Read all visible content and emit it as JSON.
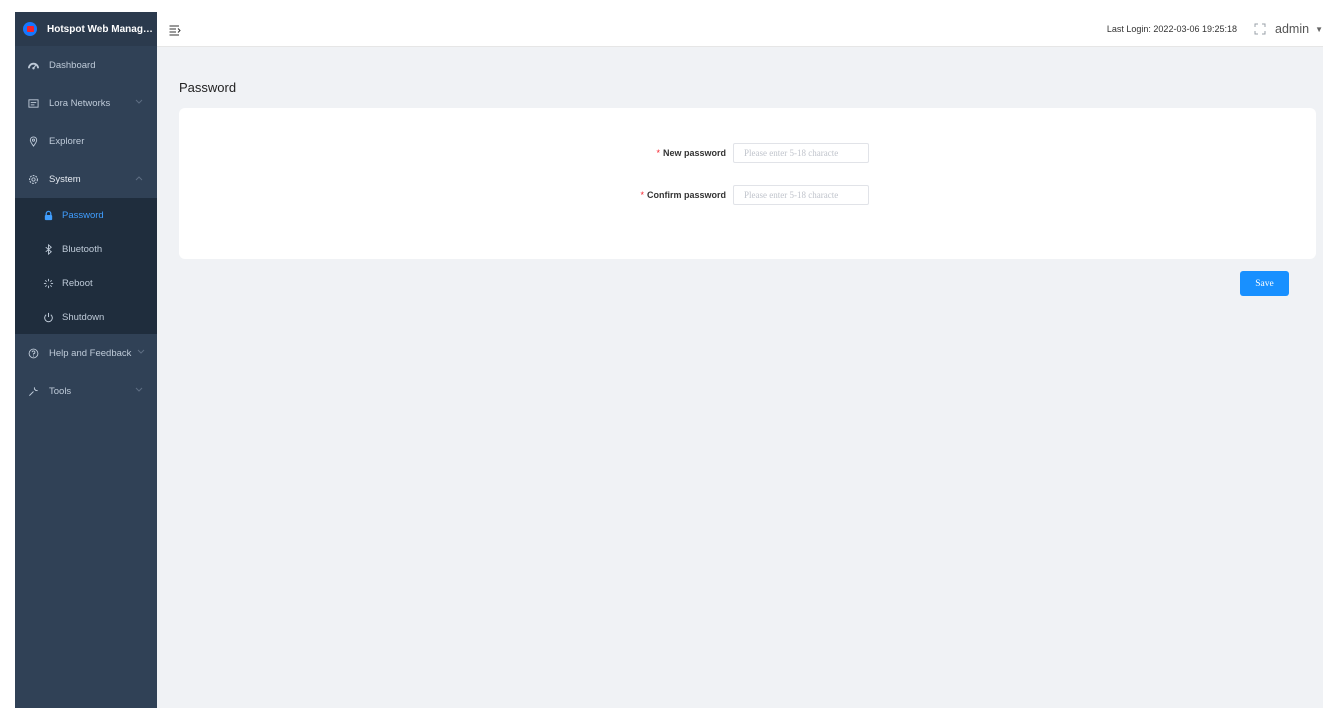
{
  "app": {
    "title": "Hotspot Web Manag…"
  },
  "sidebar": {
    "items": [
      {
        "label": "Dashboard",
        "icon": "dashboard-icon"
      },
      {
        "label": "Lora Networks",
        "icon": "network-icon"
      },
      {
        "label": "Explorer",
        "icon": "location-icon"
      },
      {
        "label": "System",
        "icon": "gear-icon"
      },
      {
        "label": "Help and Feedback",
        "icon": "help-icon"
      },
      {
        "label": "Tools",
        "icon": "wrench-icon"
      }
    ],
    "system_submenu": [
      {
        "label": "Password",
        "icon": "lock-icon",
        "active": true
      },
      {
        "label": "Bluetooth",
        "icon": "bluetooth-icon"
      },
      {
        "label": "Reboot",
        "icon": "reboot-icon"
      },
      {
        "label": "Shutdown",
        "icon": "power-icon"
      }
    ]
  },
  "header": {
    "last_login": "Last Login: 2022-03-06 19:25:18",
    "user": "admin"
  },
  "page": {
    "title": "Password"
  },
  "form": {
    "new_password": {
      "required_mark": "*",
      "label": "New password",
      "placeholder": "Please enter 5-18 characte",
      "value": ""
    },
    "confirm_password": {
      "required_mark": "*",
      "label": "Confirm password",
      "placeholder": "Please enter 5-18 characte",
      "value": ""
    },
    "save_label": "Save"
  },
  "colors": {
    "sidebar_bg": "#304156",
    "submenu_bg": "#1f2d3d",
    "active": "#409eff",
    "primary_button": "#1890ff",
    "required": "#f5222d",
    "content_bg": "#f0f2f5"
  }
}
